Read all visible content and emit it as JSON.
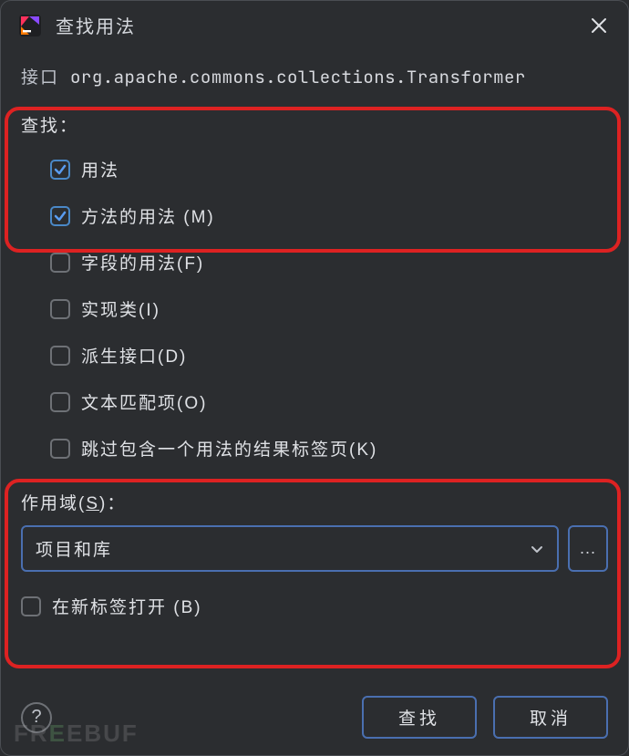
{
  "titlebar": {
    "title": "查找用法"
  },
  "target": {
    "label": "接口",
    "class_fqn": "org.apache.commons.collections.Transformer"
  },
  "find": {
    "label": "查找：",
    "options": [
      {
        "label": "用法",
        "checked": true
      },
      {
        "label": "方法的用法 (M)",
        "checked": true
      },
      {
        "label": "字段的用法(F)",
        "checked": false
      },
      {
        "label": "实现类(I)",
        "checked": false
      },
      {
        "label": "派生接口(D)",
        "checked": false
      },
      {
        "label": "文本匹配项(O)",
        "checked": false
      },
      {
        "label": "跳过包含一个用法的结果标签页(K)",
        "checked": false
      }
    ]
  },
  "scope": {
    "label_pre": "作用域(",
    "label_mnemonic": "S",
    "label_post": ")：",
    "selected": "项目和库",
    "more": "..."
  },
  "newtab": {
    "label": "在新标签打开 (B)",
    "checked": false
  },
  "footer": {
    "help": "?",
    "find": "查找",
    "cancel": "取消"
  },
  "watermark": {
    "text_pre": "FR",
    "e1": "E",
    "text_mid": "EBUF"
  }
}
